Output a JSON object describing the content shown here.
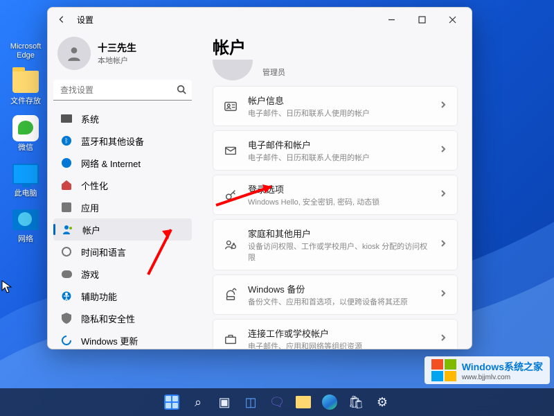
{
  "desktop_icons": [
    {
      "label": "Microsoft Edge"
    },
    {
      "label": "文件存放"
    },
    {
      "label": "微信"
    },
    {
      "label": "此电脑"
    },
    {
      "label": "网络"
    }
  ],
  "window": {
    "title": "设置",
    "user": {
      "name": "十三先生",
      "type": "本地帐户"
    },
    "search_placeholder": "查找设置",
    "nav": [
      {
        "label": "系统"
      },
      {
        "label": "蓝牙和其他设备"
      },
      {
        "label": "网络 & Internet"
      },
      {
        "label": "个性化"
      },
      {
        "label": "应用"
      },
      {
        "label": "帐户"
      },
      {
        "label": "时间和语言"
      },
      {
        "label": "游戏"
      },
      {
        "label": "辅助功能"
      },
      {
        "label": "隐私和安全性"
      },
      {
        "label": "Windows 更新"
      }
    ],
    "page": {
      "title": "帐户",
      "role": "管理员",
      "cards": [
        {
          "title": "帐户信息",
          "sub": "电子邮件、日历和联系人使用的帐户"
        },
        {
          "title": "电子邮件和帐户",
          "sub": "电子邮件、日历和联系人使用的帐户"
        },
        {
          "title": "登录选项",
          "sub": "Windows Hello, 安全密钥, 密码, 动态锁"
        },
        {
          "title": "家庭和其他用户",
          "sub": "设备访问权限、工作或学校用户、kiosk 分配的访问权限"
        },
        {
          "title": "Windows 备份",
          "sub": "备份文件、应用和首选项，以便跨设备将其还原"
        },
        {
          "title": "连接工作或学校帐户",
          "sub": "电子邮件、应用和网络等组织资源"
        }
      ]
    }
  },
  "watermark": {
    "title": "Windows系统之家",
    "url": "www.bjjmlv.com"
  }
}
